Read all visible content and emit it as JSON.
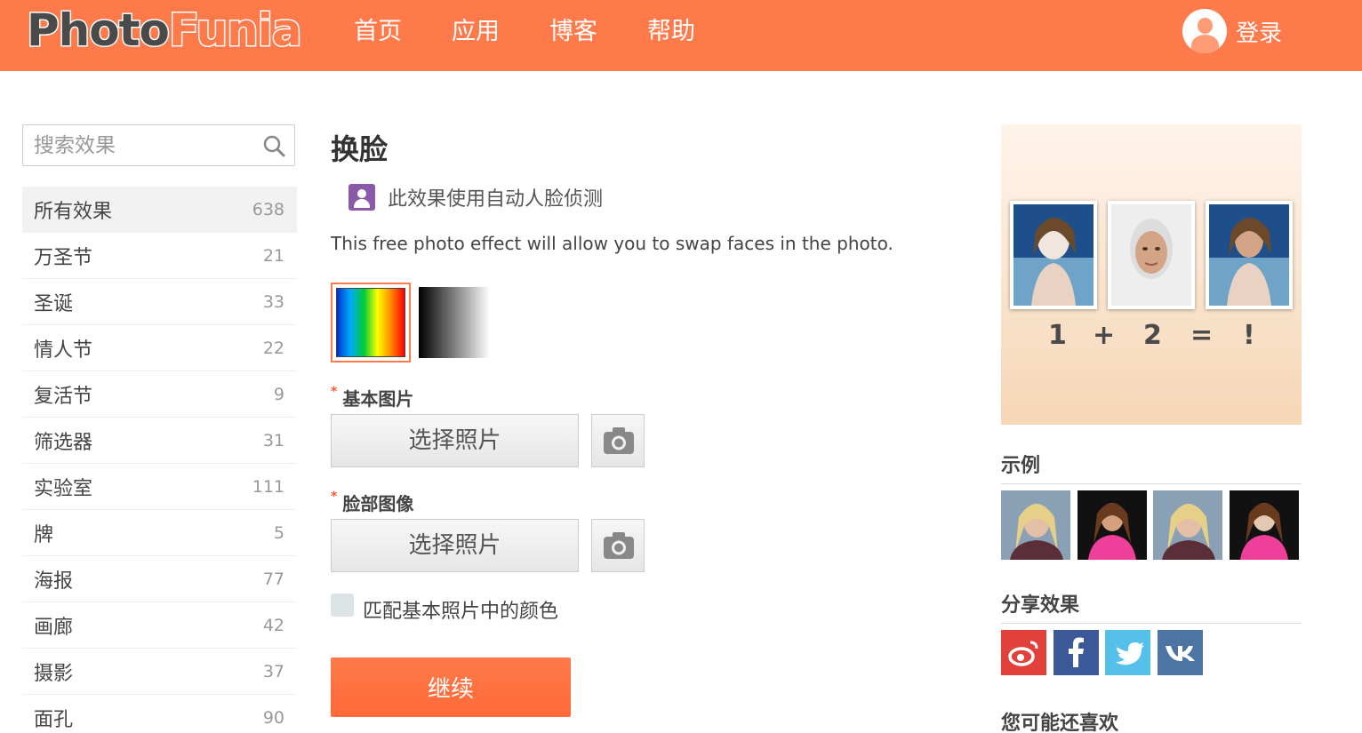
{
  "header": {
    "logo_part1": "Photo",
    "logo_part2": "Funia",
    "nav": [
      "首页",
      "应用",
      "博客",
      "帮助"
    ],
    "login": "登录",
    "accent": "#ff7a4a"
  },
  "sidebar": {
    "search_placeholder": "搜索效果",
    "categories": [
      {
        "name": "所有效果",
        "count": "638"
      },
      {
        "name": "万圣节",
        "count": "21"
      },
      {
        "name": "圣诞",
        "count": "33"
      },
      {
        "name": "情人节",
        "count": "22"
      },
      {
        "name": "复活节",
        "count": "9"
      },
      {
        "name": "筛选器",
        "count": "31"
      },
      {
        "name": "实验室",
        "count": "111"
      },
      {
        "name": "牌",
        "count": "5"
      },
      {
        "name": "海报",
        "count": "77"
      },
      {
        "name": "画廊",
        "count": "42"
      },
      {
        "name": "摄影",
        "count": "37"
      },
      {
        "name": "面孔",
        "count": "90"
      }
    ]
  },
  "main": {
    "title": "换脸",
    "face_detect": "此效果使用自动人脸侦测",
    "description": "This free photo effect will allow you to swap faces in the photo.",
    "base_label": "基本图片",
    "face_label": "脸部图像",
    "required_mark": "*",
    "pick_button": "选择照片",
    "match_colors": "匹配基本照片中的颜色",
    "continue": "继续"
  },
  "right": {
    "equation": [
      "1",
      "+",
      "2",
      "=",
      "!"
    ],
    "examples_title": "示例",
    "share_title": "分享效果",
    "share_icons": [
      "weibo-icon",
      "facebook-icon",
      "twitter-icon",
      "vk-icon"
    ],
    "share_colors": [
      "#e0413a",
      "#3b5998",
      "#55c1ea",
      "#4c75a3"
    ],
    "more_title": "您可能还喜欢"
  }
}
